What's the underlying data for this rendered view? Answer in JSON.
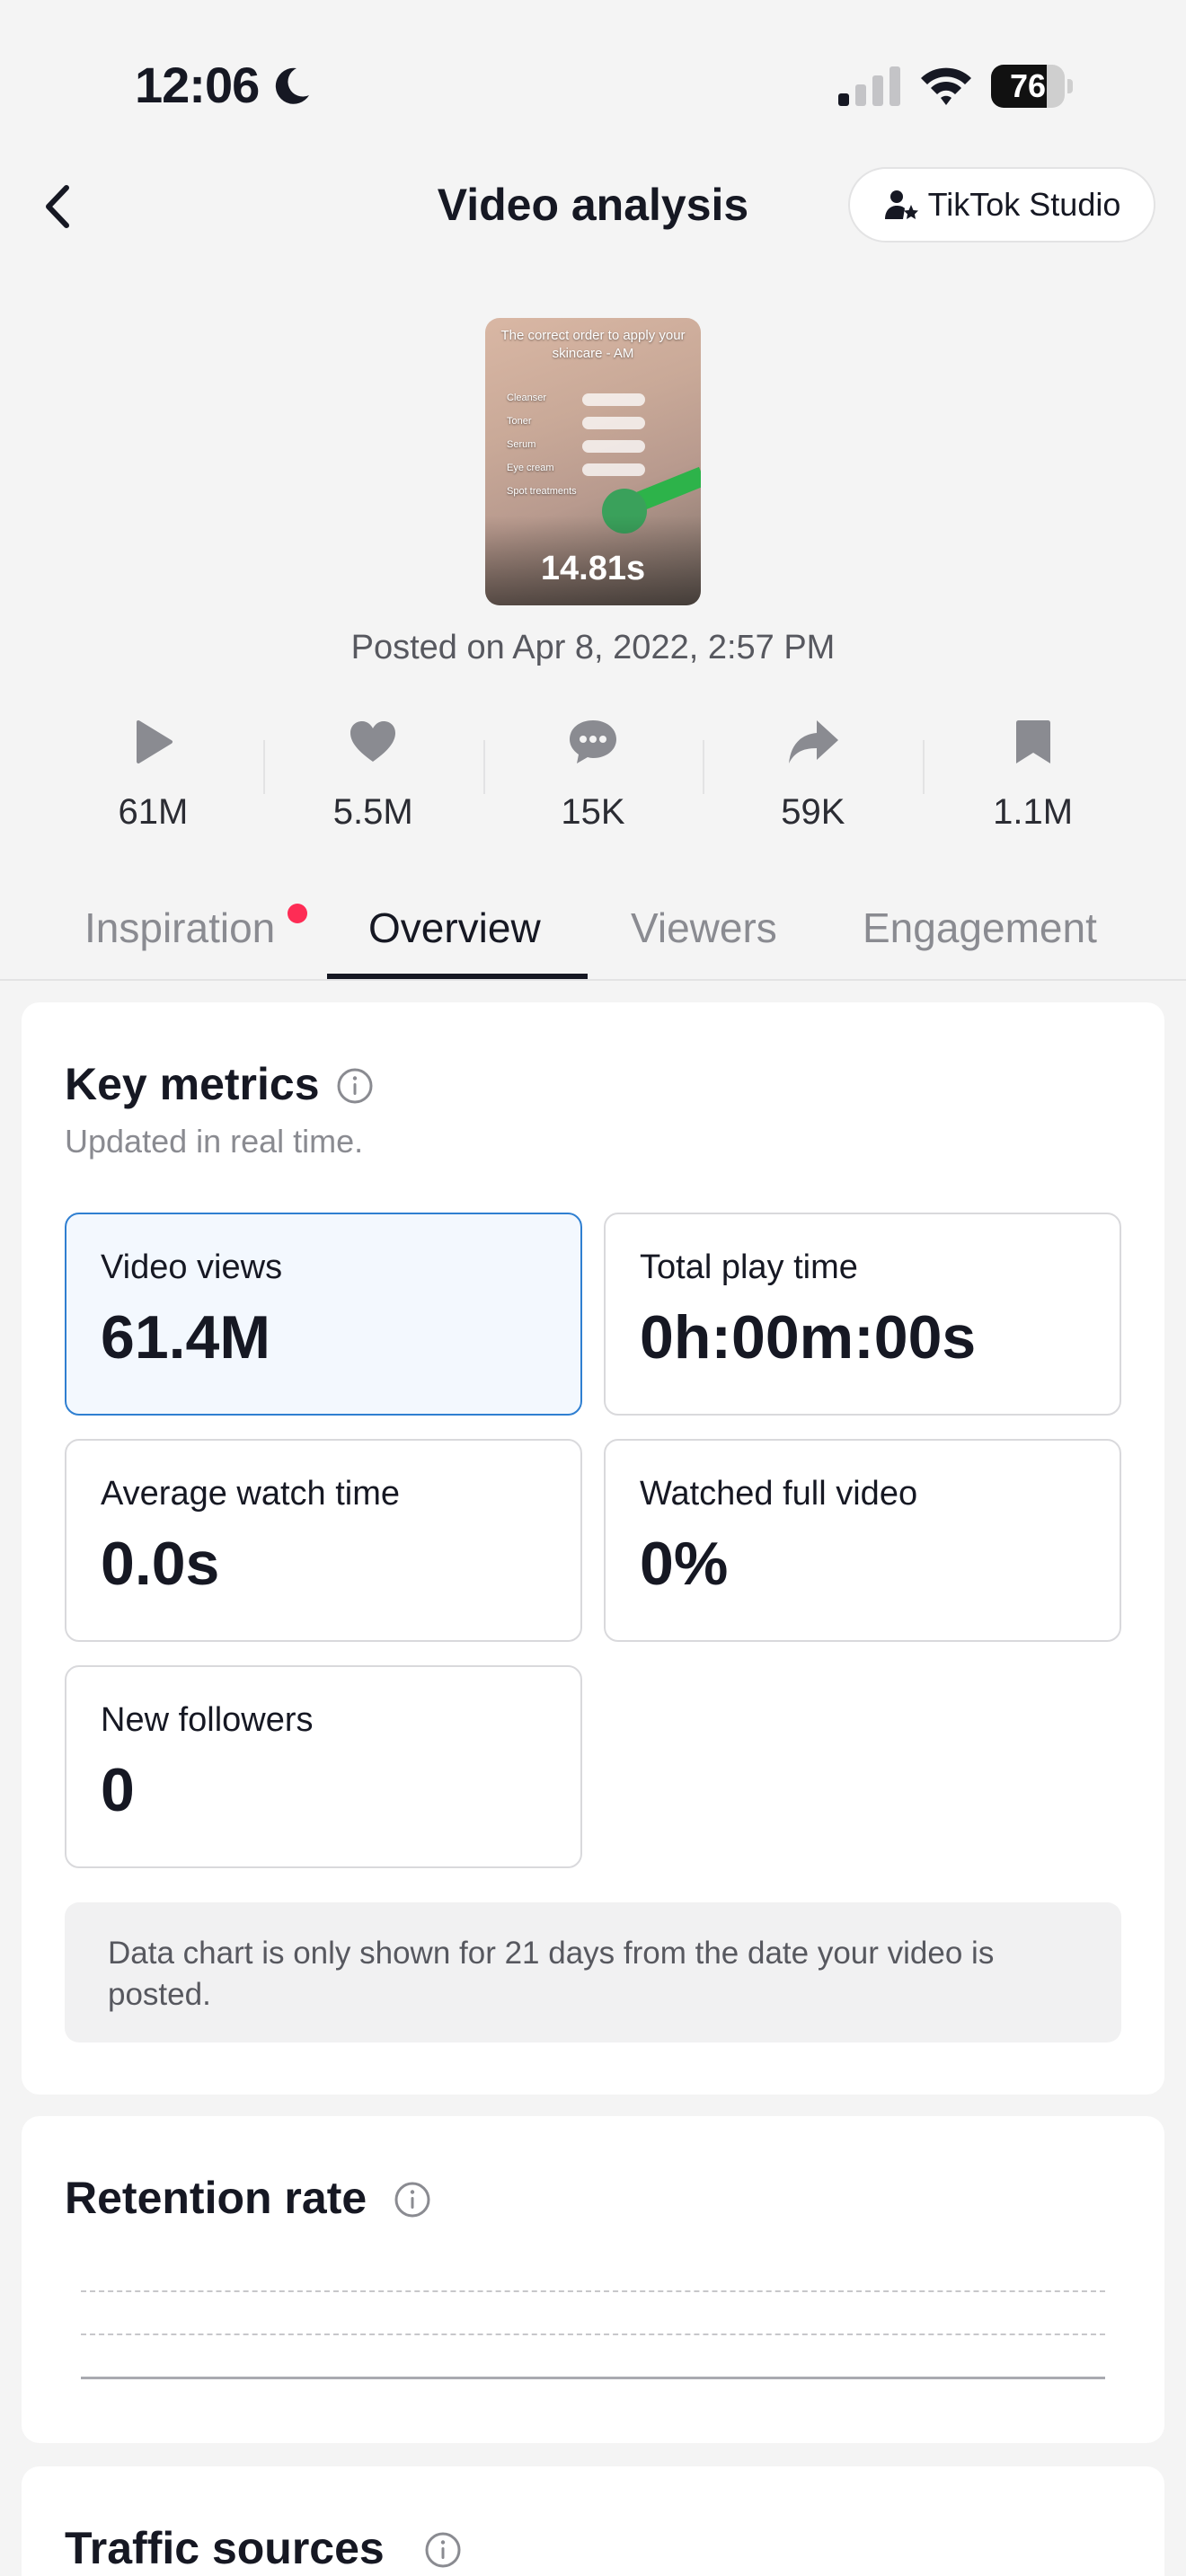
{
  "status_bar": {
    "time": "12:06",
    "battery": "76",
    "battery_level": 0.76
  },
  "header": {
    "title": "Video analysis",
    "studio_button": "TikTok Studio"
  },
  "video": {
    "thumbnail_caption": "The correct order to apply your skincare - AM",
    "thumbnail_steps": [
      "Cleanser",
      "Toner",
      "Serum",
      "Eye cream",
      "Spot treatments"
    ],
    "duration": "14.81s",
    "posted_on": "Posted on Apr 8, 2022, 2:57 PM"
  },
  "stats": [
    {
      "icon": "play-icon",
      "value": "61M"
    },
    {
      "icon": "heart-icon",
      "value": "5.5M"
    },
    {
      "icon": "comment-icon",
      "value": "15K"
    },
    {
      "icon": "share-icon",
      "value": "59K"
    },
    {
      "icon": "bookmark-icon",
      "value": "1.1M"
    }
  ],
  "tabs": [
    {
      "label": "Inspiration",
      "has_dot": true
    },
    {
      "label": "Overview",
      "active": true
    },
    {
      "label": "Viewers"
    },
    {
      "label": "Engagement"
    }
  ],
  "key_metrics": {
    "title": "Key metrics",
    "subtitle": "Updated in real time.",
    "metrics": [
      {
        "label": "Video views",
        "value": "61.4M",
        "selected": true
      },
      {
        "label": "Total play time",
        "value": "0h:00m:00s"
      },
      {
        "label": "Average watch time",
        "value": "0.0s"
      },
      {
        "label": "Watched full video",
        "value": "0%"
      },
      {
        "label": "New followers",
        "value": "0"
      }
    ],
    "notice": "Data chart is only shown for 21 days from the date your video is posted."
  },
  "retention": {
    "title": "Retention rate"
  },
  "traffic": {
    "title": "Traffic sources"
  },
  "colors": {
    "accent_blue": "#2f7fd1",
    "notification_dot": "#fe2c55",
    "text_primary": "#161823",
    "text_secondary": "#8a8b91"
  }
}
